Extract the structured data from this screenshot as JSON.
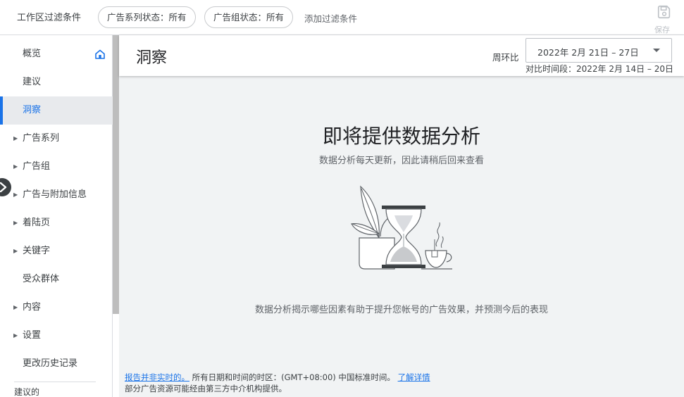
{
  "topbar": {
    "title": "工作区过滤条件",
    "filters": [
      "广告系列状态：所有",
      "广告组状态：所有"
    ],
    "add_filter": "添加过滤条件",
    "save_label": "保存"
  },
  "sidebar": {
    "items": [
      {
        "label": "概览"
      },
      {
        "label": "建议"
      },
      {
        "label": "洞察"
      },
      {
        "label": "广告系列"
      },
      {
        "label": "广告组"
      },
      {
        "label": "广告与附加信息"
      },
      {
        "label": "着陆页"
      },
      {
        "label": "关键字"
      },
      {
        "label": "受众群体"
      },
      {
        "label": "内容"
      },
      {
        "label": "设置"
      },
      {
        "label": "更改历史记录"
      }
    ],
    "footer_label": "建议的"
  },
  "header": {
    "title": "洞察",
    "compare_label": "周环比",
    "date_range": "2022年 2月 21日 – 27日",
    "compare_period": "对比时间段：2022年 2月 14日 – 20日"
  },
  "empty_state": {
    "title": "即将提供数据分析",
    "subtitle": "数据分析每天更新，因此请稍后回来查看",
    "description": "数据分析揭示哪些因素有助于提升您帐号的广告效果，并预测今后的表现"
  },
  "footer": {
    "link_text": "报告并非实时的。",
    "timezone_text": "所有日期和时间的时区：(GMT+08:00) 中国标准时间。",
    "learn_more": "了解详情",
    "line2": "部分广告资源可能经由第三方中介机构提供。"
  },
  "colors": {
    "accent": "#1a73e8",
    "active_bg": "#e8eaed",
    "main_bg": "#f1f3f4"
  },
  "icons": {
    "save": "save-icon",
    "home": "home-icon",
    "collapse": "chevron-right-icon",
    "expand": "triangle-right-icon",
    "dropdown": "caret-down-icon"
  }
}
